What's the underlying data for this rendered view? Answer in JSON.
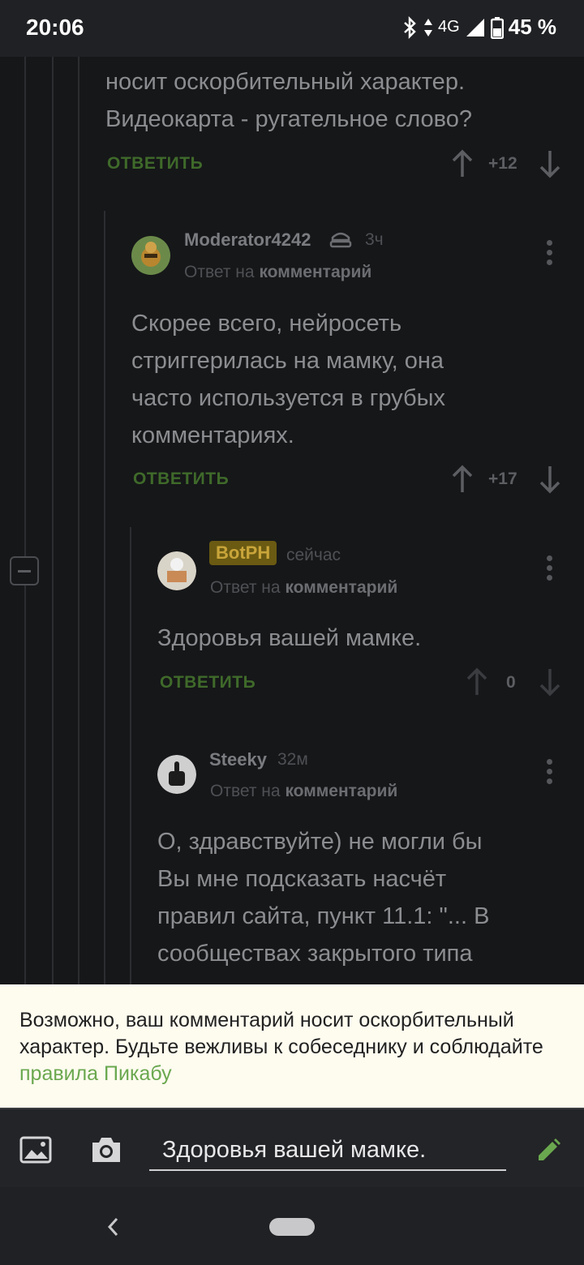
{
  "status": {
    "time": "20:06",
    "network": "4G",
    "battery": "45 %"
  },
  "comments": [
    {
      "text_line1": "носит оскорбительный характер.",
      "text_line2": "Видеокарта - ругательное слово?",
      "reply_label": "ОТВЕТИТЬ",
      "score": "+12"
    },
    {
      "username": "Moderator4242",
      "time": "3ч",
      "reply_to_prefix": "Ответ на",
      "reply_to_link": "комментарий",
      "text_line1": "Скорее всего, нейросеть",
      "text_line2": "стриггерилась на мамку, она",
      "text_line3": "часто используется в грубых",
      "text_line4": "комментариях.",
      "reply_label": "ОТВЕТИТЬ",
      "score": "+17"
    },
    {
      "username": "BotPH",
      "time": "сейчас",
      "reply_to_prefix": "Ответ на",
      "reply_to_link": "комментарий",
      "text_line1": "Здоровья вашей мамке.",
      "reply_label": "ОТВЕТИТЬ",
      "score": "0"
    },
    {
      "username": "Steeky",
      "time": "32м",
      "reply_to_prefix": "Ответ на",
      "reply_to_link": "комментарий",
      "text_line1": "О, здравствуйте) не могли бы",
      "text_line2": "Вы мне подсказать насчёт",
      "text_line3": "правил сайта, пункт 11.1: \"... В",
      "text_line4": "сообществах закрытого типа"
    }
  ],
  "warning": {
    "text": "Возможно, ваш комментарий носит оскорбительный характер. Будьте вежливы к собеседнику и соблюдайте ",
    "link": "правила Пикабу"
  },
  "composer": {
    "value": "Здоровья вашей мамке."
  },
  "colors": {
    "accent_green": "#6aa84f",
    "reply_green": "#3f6a2a",
    "bot_badge": "#6a5a12"
  }
}
